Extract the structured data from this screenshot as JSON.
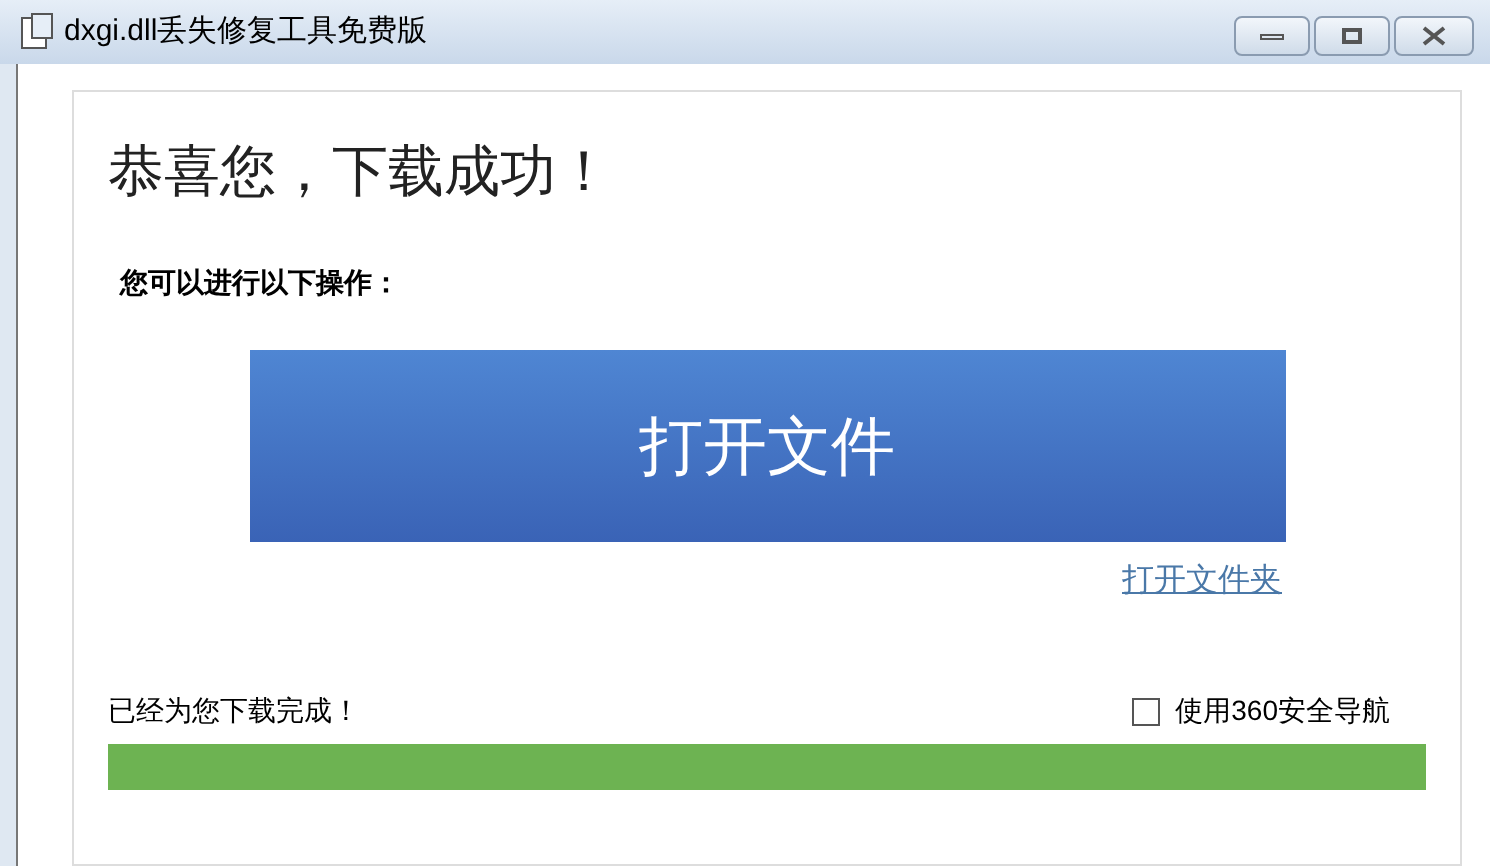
{
  "window": {
    "title": "dxgi.dll丢失修复工具免费版"
  },
  "heading": "恭喜您，下载成功！",
  "prompt": "您可以进行以下操作：",
  "open_file_button": "打开文件",
  "open_folder_link": "打开文件夹",
  "status": "已经为您下载完成！",
  "nav_option": {
    "label": "使用360安全导航",
    "checked": false
  },
  "progress": {
    "level": 1
  }
}
